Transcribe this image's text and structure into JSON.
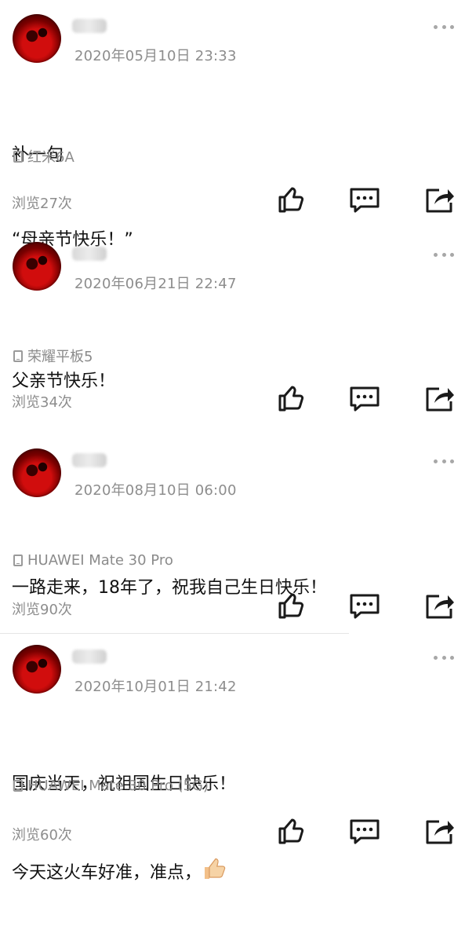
{
  "posts": [
    {
      "time": "2020年05月10日 23:33",
      "lines": [
        "补一句",
        "“母亲节快乐！”"
      ],
      "device": "红米6A",
      "views": "浏览27次"
    },
    {
      "time": "2020年06月21日 22:47",
      "lines": [
        "父亲节快乐！"
      ],
      "device": "荣耀平板5",
      "views": "浏览34次"
    },
    {
      "time": "2020年08月10日 06:00",
      "lines": [
        "一路走来，18年了，祝我自己生日快乐！"
      ],
      "device": "HUAWEI Mate 30 Pro",
      "views": "浏览90次"
    },
    {
      "time": "2020年10月01日 21:42",
      "lines": [
        "国庆当天，祝祖国生日快乐！",
        "今天这火车好准，准点，"
      ],
      "device": "HUAWEI Mate 30 Pro (5G)",
      "views": "浏览60次",
      "emoji": "thumbs-up"
    }
  ],
  "icons": {
    "like": "thumbs-up-icon",
    "comment": "comment-bubble-icon",
    "share": "share-arrow-icon",
    "more": "more-dots-icon",
    "device": "phone-icon"
  },
  "colors": {
    "text": "#111111",
    "meta": "#8d8d8d",
    "icon": "#1a1a1a",
    "avatar": "#d10d0d"
  }
}
